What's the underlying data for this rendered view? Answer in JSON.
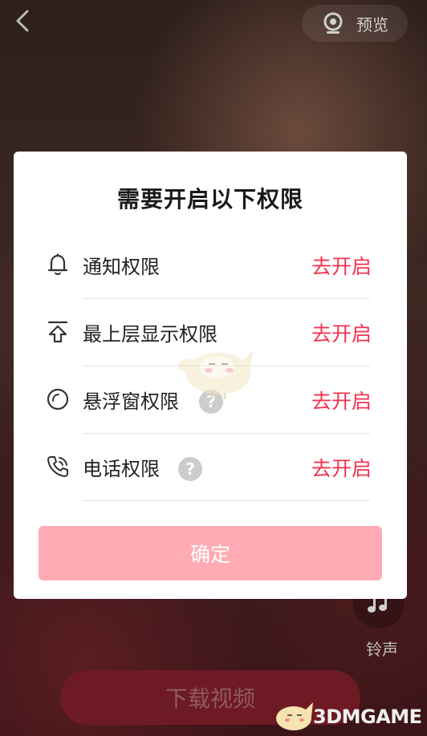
{
  "topbar": {
    "back_icon": "chevron-left-icon",
    "preview_icon": "webcam-icon",
    "preview_label": "预览"
  },
  "side": {
    "ringtone_icon": "music-note-icon",
    "ringtone_label": "铃声"
  },
  "download_label": "下载视频",
  "dialog": {
    "title": "需要开启以下权限",
    "permissions": [
      {
        "icon": "bell-icon",
        "label": "通知权限",
        "help": false,
        "action": "去开启"
      },
      {
        "icon": "arrow-up-top-icon",
        "label": "最上层显示权限",
        "help": false,
        "action": "去开启"
      },
      {
        "icon": "circle-icon",
        "label": "悬浮窗权限",
        "help": true,
        "help_text": "?",
        "action": "去开启"
      },
      {
        "icon": "phone-icon",
        "label": "电话权限",
        "help": true,
        "help_text": "?",
        "action": "去开启"
      }
    ],
    "confirm_label": "确定"
  },
  "watermark": {
    "text": "3DMGAME"
  },
  "colors": {
    "accent": "#f2334f",
    "confirm_bg": "#ffabb3",
    "download_bg": "#6e1a24"
  }
}
